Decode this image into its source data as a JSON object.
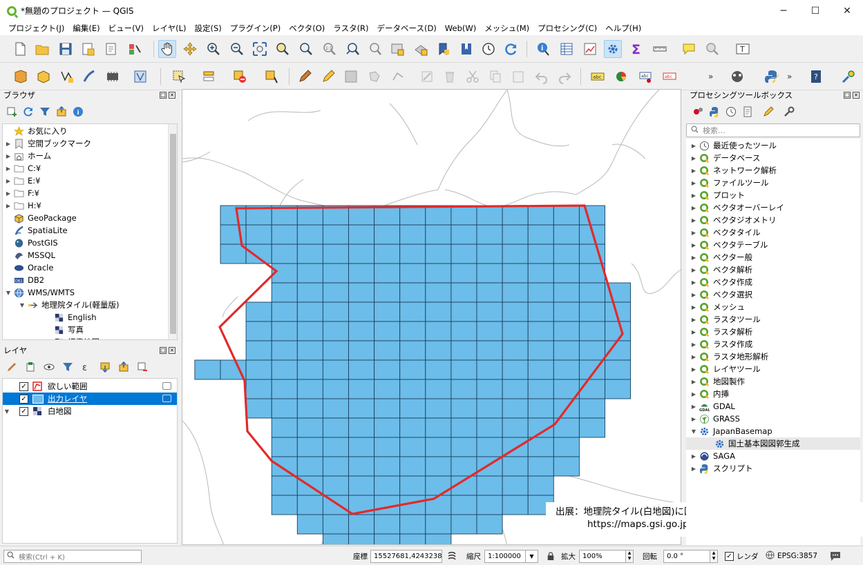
{
  "window": {
    "title": "*無題のプロジェクト — QGIS",
    "minimize": "─",
    "maximize": "☐",
    "close": "✕"
  },
  "menu": [
    "プロジェクト(J)",
    "編集(E)",
    "ビュー(V)",
    "レイヤ(L)",
    "設定(S)",
    "プラグイン(P)",
    "ベクタ(O)",
    "ラスタ(R)",
    "データベース(D)",
    "Web(W)",
    "メッシュ(M)",
    "プロセシング(C)",
    "ヘルプ(H)"
  ],
  "browser": {
    "title": "ブラウザ",
    "items": [
      {
        "label": "お気に入り",
        "icon": "star-icon",
        "arrow": ""
      },
      {
        "label": "空間ブックマーク",
        "icon": "bookmark-icon",
        "arrow": "▶"
      },
      {
        "label": "ホーム",
        "icon": "home-folder-icon",
        "arrow": "▶"
      },
      {
        "label": "C:¥",
        "icon": "folder-icon",
        "arrow": "▶"
      },
      {
        "label": "E:¥",
        "icon": "folder-icon",
        "arrow": "▶"
      },
      {
        "label": "F:¥",
        "icon": "folder-icon",
        "arrow": "▶"
      },
      {
        "label": "H:¥",
        "icon": "folder-icon",
        "arrow": "▶"
      },
      {
        "label": "GeoPackage",
        "icon": "geopackage-icon",
        "arrow": ""
      },
      {
        "label": "SpatiaLite",
        "icon": "spatialite-icon",
        "arrow": ""
      },
      {
        "label": "PostGIS",
        "icon": "postgis-icon",
        "arrow": ""
      },
      {
        "label": "MSSQL",
        "icon": "mssql-icon",
        "arrow": ""
      },
      {
        "label": "Oracle",
        "icon": "oracle-icon",
        "arrow": ""
      },
      {
        "label": "DB2",
        "icon": "db2-icon",
        "arrow": ""
      },
      {
        "label": "WMS/WMTS",
        "icon": "globe-icon",
        "arrow": "▼"
      },
      {
        "label": "地理院タイル(軽量版)",
        "icon": "wms-connection-icon",
        "arrow": "▼"
      },
      {
        "label": "English",
        "icon": "raster-tile-icon",
        "arrow": ""
      },
      {
        "label": "写真",
        "icon": "raster-tile-icon",
        "arrow": ""
      },
      {
        "label": "標準地図",
        "icon": "raster-tile-icon",
        "arrow": ""
      }
    ]
  },
  "layers": {
    "title": "レイヤ",
    "items": [
      {
        "label": "欲しい範囲",
        "checked": "✓",
        "selected": false
      },
      {
        "label": "出力レイヤ",
        "checked": "✓",
        "selected": true
      },
      {
        "label": "白地図",
        "checked": "✓",
        "selected": false
      }
    ]
  },
  "processing": {
    "title": "プロセシングツールボックス",
    "search_placeholder": "検索...",
    "items": [
      {
        "label": "最近使ったツール",
        "icon": "clock-icon",
        "arrow": "▶"
      },
      {
        "label": "データベース",
        "icon": "qgis-provider-icon",
        "arrow": "▶"
      },
      {
        "label": "ネットワーク解析",
        "icon": "qgis-provider-icon",
        "arrow": "▶"
      },
      {
        "label": "ファイルツール",
        "icon": "qgis-provider-icon",
        "arrow": "▶"
      },
      {
        "label": "プロット",
        "icon": "qgis-provider-icon",
        "arrow": "▶"
      },
      {
        "label": "ベクタオーバーレイ",
        "icon": "qgis-provider-icon",
        "arrow": "▶"
      },
      {
        "label": "ベクタジオメトリ",
        "icon": "qgis-provider-icon",
        "arrow": "▶"
      },
      {
        "label": "ベクタタイル",
        "icon": "qgis-provider-icon",
        "arrow": "▶"
      },
      {
        "label": "ベクタテーブル",
        "icon": "qgis-provider-icon",
        "arrow": "▶"
      },
      {
        "label": "ベクター般",
        "icon": "qgis-provider-icon",
        "arrow": "▶"
      },
      {
        "label": "ベクタ解析",
        "icon": "qgis-provider-icon",
        "arrow": "▶"
      },
      {
        "label": "ベクタ作成",
        "icon": "qgis-provider-icon",
        "arrow": "▶"
      },
      {
        "label": "ベクタ選択",
        "icon": "qgis-provider-icon",
        "arrow": "▶"
      },
      {
        "label": "メッシュ",
        "icon": "qgis-provider-icon",
        "arrow": "▶"
      },
      {
        "label": "ラスタツール",
        "icon": "qgis-provider-icon",
        "arrow": "▶"
      },
      {
        "label": "ラスタ解析",
        "icon": "qgis-provider-icon",
        "arrow": "▶"
      },
      {
        "label": "ラスタ作成",
        "icon": "qgis-provider-icon",
        "arrow": "▶"
      },
      {
        "label": "ラスタ地形解析",
        "icon": "qgis-provider-icon",
        "arrow": "▶"
      },
      {
        "label": "レイヤツール",
        "icon": "qgis-provider-icon",
        "arrow": "▶"
      },
      {
        "label": "地図製作",
        "icon": "qgis-provider-icon",
        "arrow": "▶"
      },
      {
        "label": "内挿",
        "icon": "qgis-provider-icon",
        "arrow": "▶"
      },
      {
        "label": "GDAL",
        "icon": "gdal-icon",
        "arrow": "▶"
      },
      {
        "label": "GRASS",
        "icon": "grass-icon",
        "arrow": "▶"
      },
      {
        "label": "JapanBasemap",
        "icon": "gear-icon",
        "arrow": "▼"
      },
      {
        "label": "国土基本図図郭生成",
        "icon": "gear-icon",
        "arrow": ""
      },
      {
        "label": "SAGA",
        "icon": "saga-icon",
        "arrow": "▶"
      },
      {
        "label": "スクリプト",
        "icon": "python-icon",
        "arrow": "▶"
      }
    ]
  },
  "map": {
    "caption_line1": "出展：地理院タイル(白地図)に図郭と適当な図を追記して掲載",
    "caption_line2": "https://maps.gsi.go.jp/development/ichiran.html",
    "colors": {
      "grid_fill": "#6cbde9",
      "grid_stroke": "#1d3e5e",
      "polygon_stroke": "#e22a2a",
      "boundary": "#b8b8b8"
    }
  },
  "status": {
    "search_placeholder": "検索(Ctrl + K)",
    "coord_label": "座標",
    "coord_value": "15527681,4243238",
    "scale_label": "縮尺",
    "scale_value": "1:100000",
    "magnifier_label": "拡大",
    "magnifier_value": "100%",
    "rotation_label": "回転",
    "rotation_value": "0.0 °",
    "render_label": "レンダ",
    "render_checked": "✓",
    "crs": "EPSG:3857"
  }
}
